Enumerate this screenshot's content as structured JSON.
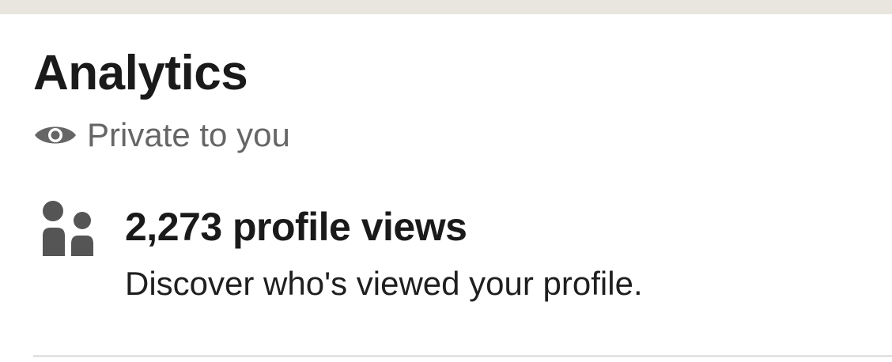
{
  "section": {
    "title": "Analytics",
    "visibility_icon": "eye-icon",
    "visibility_text": "Private to you"
  },
  "profile_views": {
    "icon": "people-icon",
    "title": "2,273 profile views",
    "subtitle": "Discover who's viewed your profile."
  },
  "colors": {
    "top_band": "#e9e5df",
    "heading": "#1a1a1a",
    "muted": "#666666",
    "icon": "#555555",
    "divider": "#e3e3e3"
  }
}
